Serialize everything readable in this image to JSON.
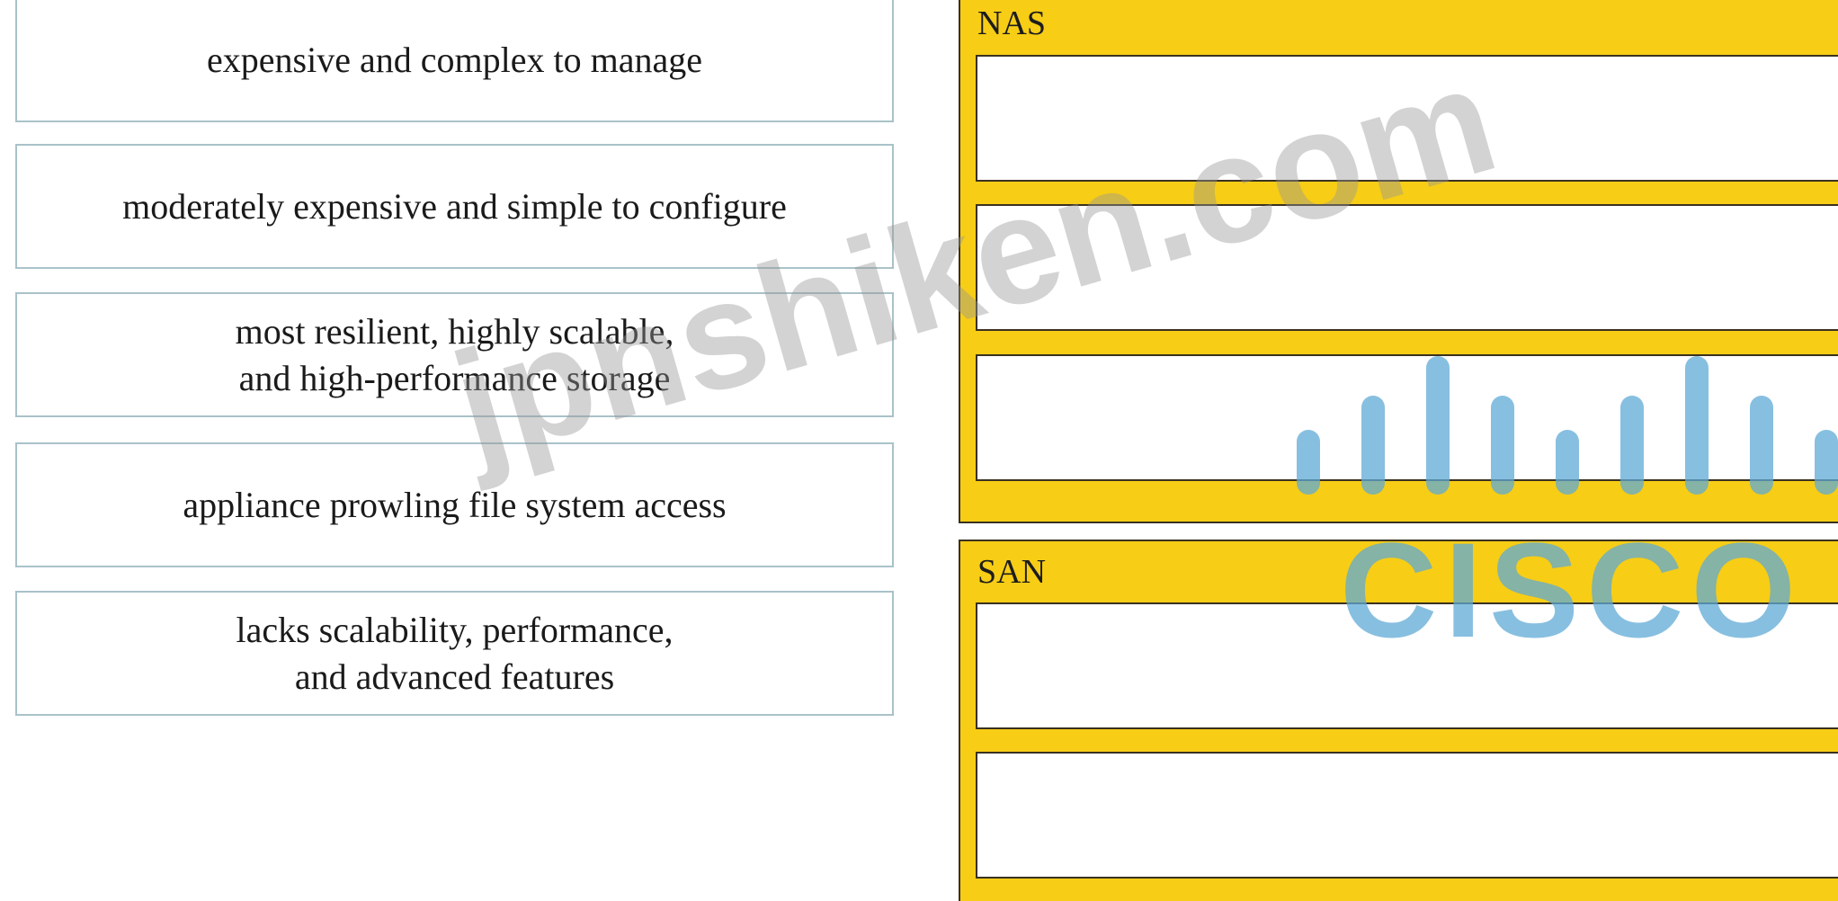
{
  "source_items": [
    {
      "lines": [
        "expensive and complex to manage"
      ]
    },
    {
      "lines": [
        "moderately expensive and simple to configure"
      ]
    },
    {
      "lines": [
        "most resilient, highly scalable,",
        "and high-performance storage"
      ]
    },
    {
      "lines": [
        "appliance prowling file system access"
      ]
    },
    {
      "lines": [
        "lacks scalability, performance,",
        "and advanced features"
      ]
    }
  ],
  "categories": [
    {
      "label": "NAS",
      "slot_count": 3
    },
    {
      "label": "SAN",
      "slot_count": 2
    }
  ],
  "watermark": {
    "text": "jpnshiken.com",
    "logo_text": "CISCO",
    "logo_color": "#5fa9d6"
  },
  "colors": {
    "category_fill": "#f7cd16",
    "slot_fill": "#ffffff",
    "item_border": "#a9c2c9"
  }
}
